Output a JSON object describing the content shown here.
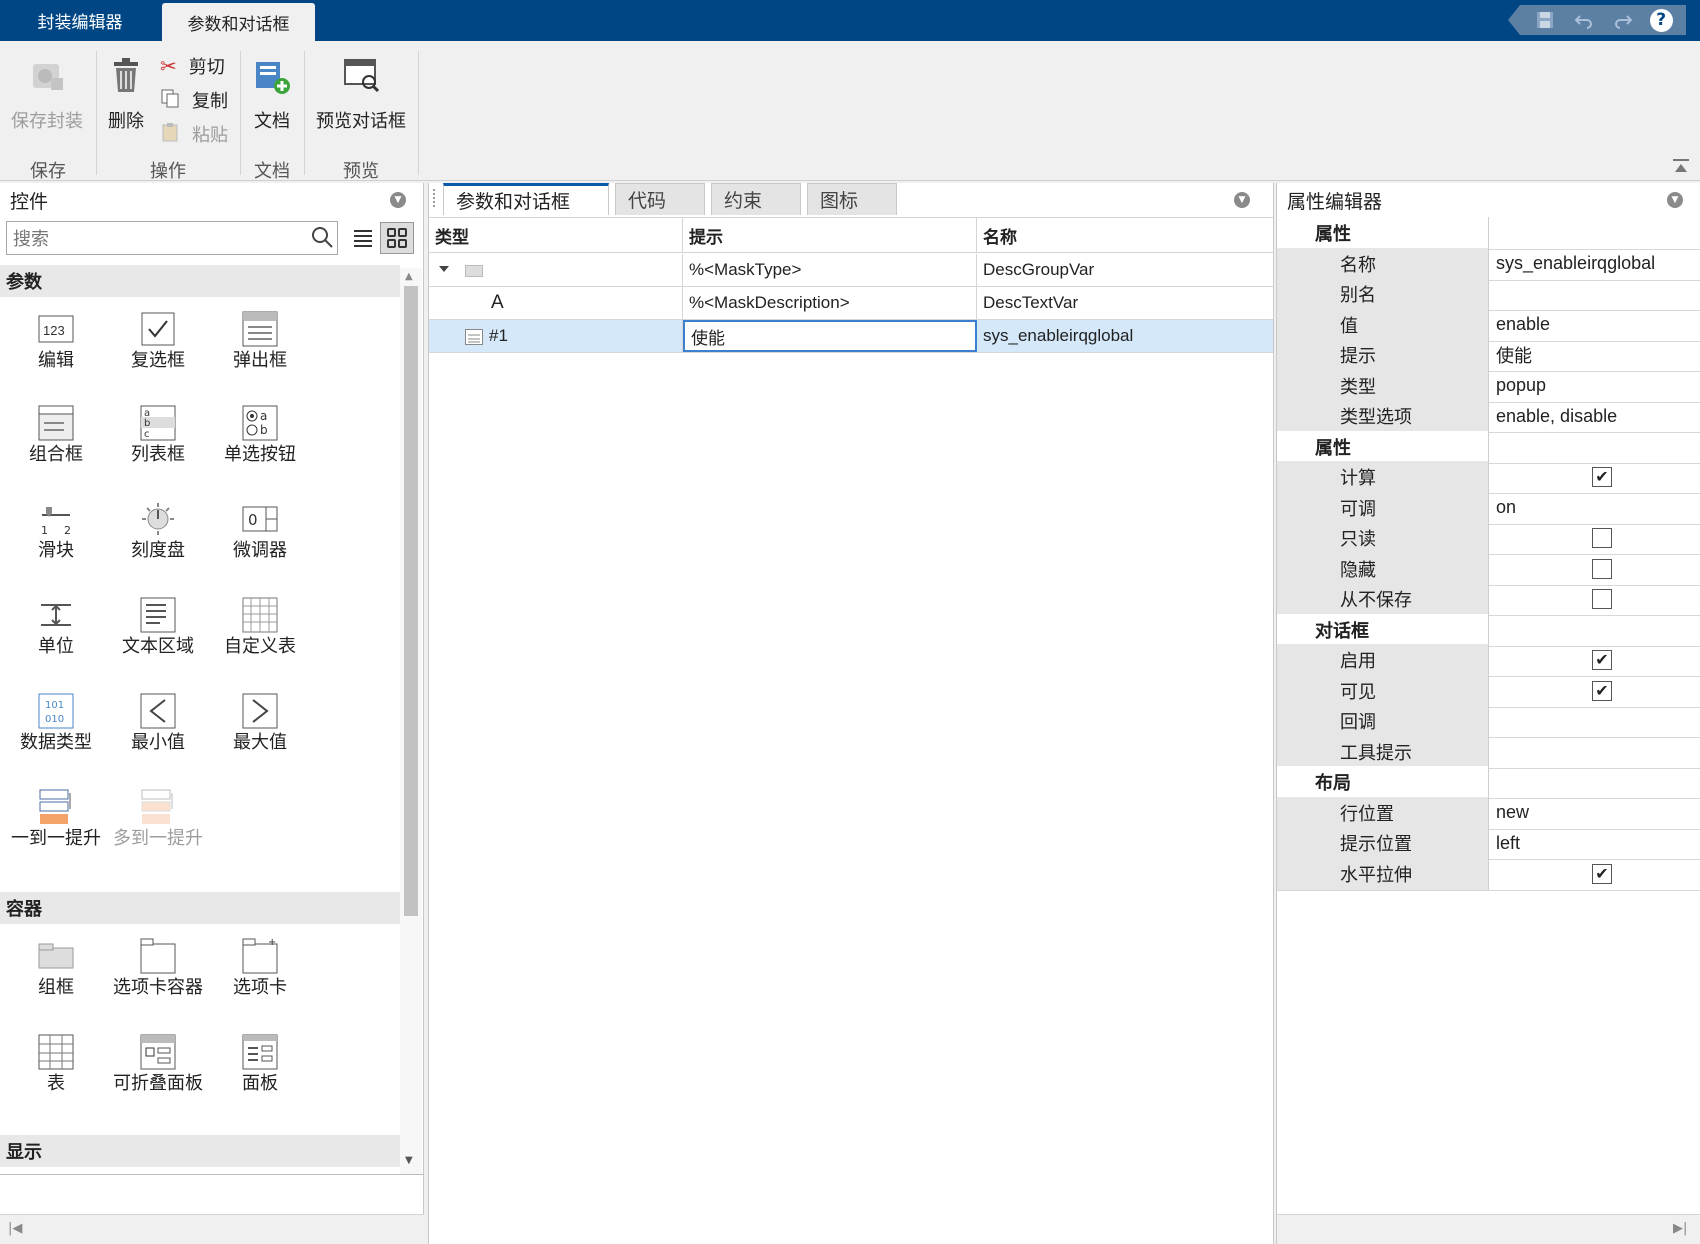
{
  "titlebar": {
    "tabs": [
      {
        "label": "封装编辑器"
      },
      {
        "label": "参数和对话框"
      }
    ],
    "quick_access": [
      "save-icon",
      "undo-icon",
      "redo-icon",
      "help-icon"
    ],
    "help_label": "?"
  },
  "toolstrip": {
    "save_mask": "保存封装",
    "delete": "删除",
    "cut": "剪切",
    "copy": "复制",
    "paste": "粘贴",
    "doc": "文档",
    "preview_dialog": "预览对话框",
    "sections": {
      "save": "保存",
      "operations": "操作",
      "doc": "文档",
      "preview": "预览"
    }
  },
  "left_panel": {
    "title": "控件",
    "search_placeholder": "搜索",
    "categories": {
      "params": "参数",
      "containers": "容器",
      "display": "显示"
    },
    "param_controls": [
      {
        "label": "编辑",
        "icon": "edit-icon"
      },
      {
        "label": "复选框",
        "icon": "checkbox-icon"
      },
      {
        "label": "弹出框",
        "icon": "popup-icon"
      },
      {
        "label": "组合框",
        "icon": "combobox-icon"
      },
      {
        "label": "列表框",
        "icon": "listbox-icon"
      },
      {
        "label": "单选按钮",
        "icon": "radio-icon"
      },
      {
        "label": "滑块",
        "icon": "slider-icon"
      },
      {
        "label": "刻度盘",
        "icon": "dial-icon"
      },
      {
        "label": "微调器",
        "icon": "spinner-icon"
      },
      {
        "label": "单位",
        "icon": "unit-icon"
      },
      {
        "label": "文本区域",
        "icon": "textarea-icon"
      },
      {
        "label": "自定义表",
        "icon": "custom-table-icon"
      },
      {
        "label": "数据类型",
        "icon": "datatype-icon"
      },
      {
        "label": "最小值",
        "icon": "min-icon"
      },
      {
        "label": "最大值",
        "icon": "max-icon"
      },
      {
        "label": "一到一提升",
        "icon": "promote-one-icon"
      },
      {
        "label": "多到一提升",
        "icon": "promote-many-icon"
      }
    ],
    "container_controls": [
      {
        "label": "组框",
        "icon": "groupbox-icon"
      },
      {
        "label": "选项卡容器",
        "icon": "tab-container-icon"
      },
      {
        "label": "选项卡",
        "icon": "tab-icon"
      },
      {
        "label": "表",
        "icon": "table-icon"
      },
      {
        "label": "可折叠面板",
        "icon": "collapsible-panel-icon"
      },
      {
        "label": "面板",
        "icon": "panel-icon"
      }
    ]
  },
  "center_panel": {
    "tabs": [
      {
        "label": "参数和对话框"
      },
      {
        "label": "代码"
      },
      {
        "label": "约束"
      },
      {
        "label": "图标"
      }
    ],
    "columns": [
      "类型",
      "提示",
      "名称"
    ],
    "rows": [
      {
        "type": "",
        "prompt": "%<MaskType>",
        "name": "DescGroupVar"
      },
      {
        "type": "A",
        "prompt": "%<MaskDescription>",
        "name": "DescTextVar"
      },
      {
        "type": "#1",
        "prompt": "使能",
        "name": "sys_enableirqglobal"
      }
    ]
  },
  "right_panel": {
    "title": "属性编辑器",
    "groups": [
      {
        "title": "属性",
        "rows": [
          {
            "label": "名称",
            "value": "sys_enableirqglobal"
          },
          {
            "label": "别名",
            "value": ""
          },
          {
            "label": "值",
            "value": "enable"
          },
          {
            "label": "提示",
            "value": "使能"
          },
          {
            "label": "类型",
            "value": "popup"
          },
          {
            "label": "类型选项",
            "value": "enable, disable"
          }
        ]
      },
      {
        "title": "属性",
        "rows": [
          {
            "label": "计算",
            "checked": true
          },
          {
            "label": "可调",
            "value": "on"
          },
          {
            "label": "只读",
            "checked": false
          },
          {
            "label": "隐藏",
            "checked": false
          },
          {
            "label": "从不保存",
            "checked": false
          }
        ]
      },
      {
        "title": "对话框",
        "rows": [
          {
            "label": "启用",
            "checked": true
          },
          {
            "label": "可见",
            "checked": true
          },
          {
            "label": "回调",
            "value": ""
          },
          {
            "label": "工具提示",
            "value": ""
          }
        ]
      },
      {
        "title": "布局",
        "rows": [
          {
            "label": "行位置",
            "value": "new"
          },
          {
            "label": "提示位置",
            "value": "left"
          },
          {
            "label": "水平拉伸",
            "checked": true
          }
        ]
      }
    ]
  }
}
